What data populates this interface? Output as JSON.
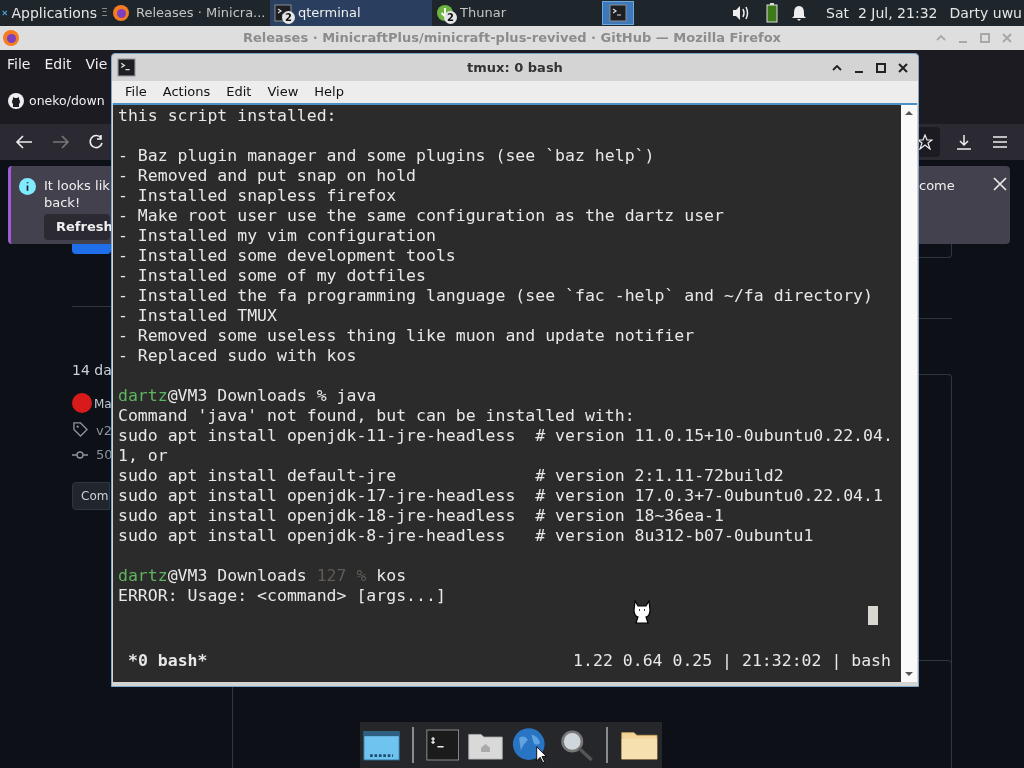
{
  "panel": {
    "apps_label": "Applications",
    "apps_glyph": "Ξ",
    "tasks": [
      {
        "kind": "browser",
        "title": "Releases · Minicra...",
        "selected": false
      },
      {
        "kind": "terminal",
        "title": "qterminal",
        "badge": "2",
        "selected": true
      },
      {
        "kind": "files",
        "title": "Thunar",
        "badge": "2",
        "selected": false
      }
    ],
    "clock": "Sat  2 Jul, 21:32",
    "user": "Darty uwu"
  },
  "firefox": {
    "title": "Releases · MinicraftPlus/minicraft-plus-revived · GitHub — Mozilla Firefox",
    "menu": [
      "File",
      "Edit",
      "Vie"
    ],
    "tab": "oneko/down",
    "notice": {
      "text": "It looks lik",
      "text_2": "back!",
      "text_right": "come",
      "button": "Refresh"
    },
    "release": {
      "time": "14 da",
      "author": "Ma",
      "tag": "v2",
      "commit": "50",
      "button": "Com"
    }
  },
  "terminal": {
    "title": "tmux: 0 bash",
    "menu": [
      "File",
      "Actions",
      "Edit",
      "View",
      "Help"
    ],
    "lines": [
      {
        "kind": "text",
        "text": "this script installed:"
      },
      {
        "kind": "blank"
      },
      {
        "kind": "text",
        "text": "- Baz plugin manager and some plugins (see `baz help`)"
      },
      {
        "kind": "text",
        "text": "- Removed and put snap on hold"
      },
      {
        "kind": "text",
        "text": "- Installed snapless firefox"
      },
      {
        "kind": "text",
        "text": "- Make root user use the same configuration as the dartz user"
      },
      {
        "kind": "text",
        "text": "- Installed my vim configuration"
      },
      {
        "kind": "text",
        "text": "- Installed some development tools"
      },
      {
        "kind": "text",
        "text": "- Installed some of my dotfiles"
      },
      {
        "kind": "text",
        "text": "- Installed the fa programming language (see `fac -help` and ~/fa directory)"
      },
      {
        "kind": "text",
        "text": "- Installed TMUX"
      },
      {
        "kind": "text",
        "text": "- Removed some useless thing like muon and update notifier"
      },
      {
        "kind": "text",
        "text": "- Replaced sudo with kos"
      },
      {
        "kind": "blank"
      },
      {
        "kind": "prompt",
        "segments": [
          {
            "kind": "user",
            "text": "dartz"
          },
          {
            "kind": "plain",
            "text": "@VM3 Downloads % java"
          }
        ]
      },
      {
        "kind": "text",
        "text": "Command 'java' not found, but can be installed with:"
      },
      {
        "kind": "text",
        "text": "sudo apt install openjdk-11-jre-headless  # version 11.0.15+10-0ubuntu0.22.04."
      },
      {
        "kind": "text",
        "text": "1, or"
      },
      {
        "kind": "text",
        "text": "sudo apt install default-jre              # version 2:1.11-72build2"
      },
      {
        "kind": "text",
        "text": "sudo apt install openjdk-17-jre-headless  # version 17.0.3+7-0ubuntu0.22.04.1"
      },
      {
        "kind": "text",
        "text": "sudo apt install openjdk-18-jre-headless  # version 18~36ea-1"
      },
      {
        "kind": "text",
        "text": "sudo apt install openjdk-8-jre-headless   # version 8u312-b07-0ubuntu1"
      },
      {
        "kind": "blank"
      },
      {
        "kind": "prompt",
        "segments": [
          {
            "kind": "user",
            "text": "dartz"
          },
          {
            "kind": "plain",
            "text": "@VM3 Downloads "
          },
          {
            "kind": "dim",
            "text": "127 %"
          },
          {
            "kind": "plain",
            "text": " kos"
          }
        ]
      },
      {
        "kind": "text",
        "text": "ERROR: Usage: <command> [args...]"
      },
      {
        "kind": "cursor"
      }
    ],
    "status_left": "*0 bash*",
    "status_right": "1.22 0.64 0.25 | 21:32:02 | bash"
  },
  "dock": [
    {
      "kind": "desktop"
    },
    {
      "kind": "sep"
    },
    {
      "kind": "terminal"
    },
    {
      "kind": "home"
    },
    {
      "kind": "web"
    },
    {
      "kind": "search"
    },
    {
      "kind": "sep"
    },
    {
      "kind": "folder"
    }
  ]
}
